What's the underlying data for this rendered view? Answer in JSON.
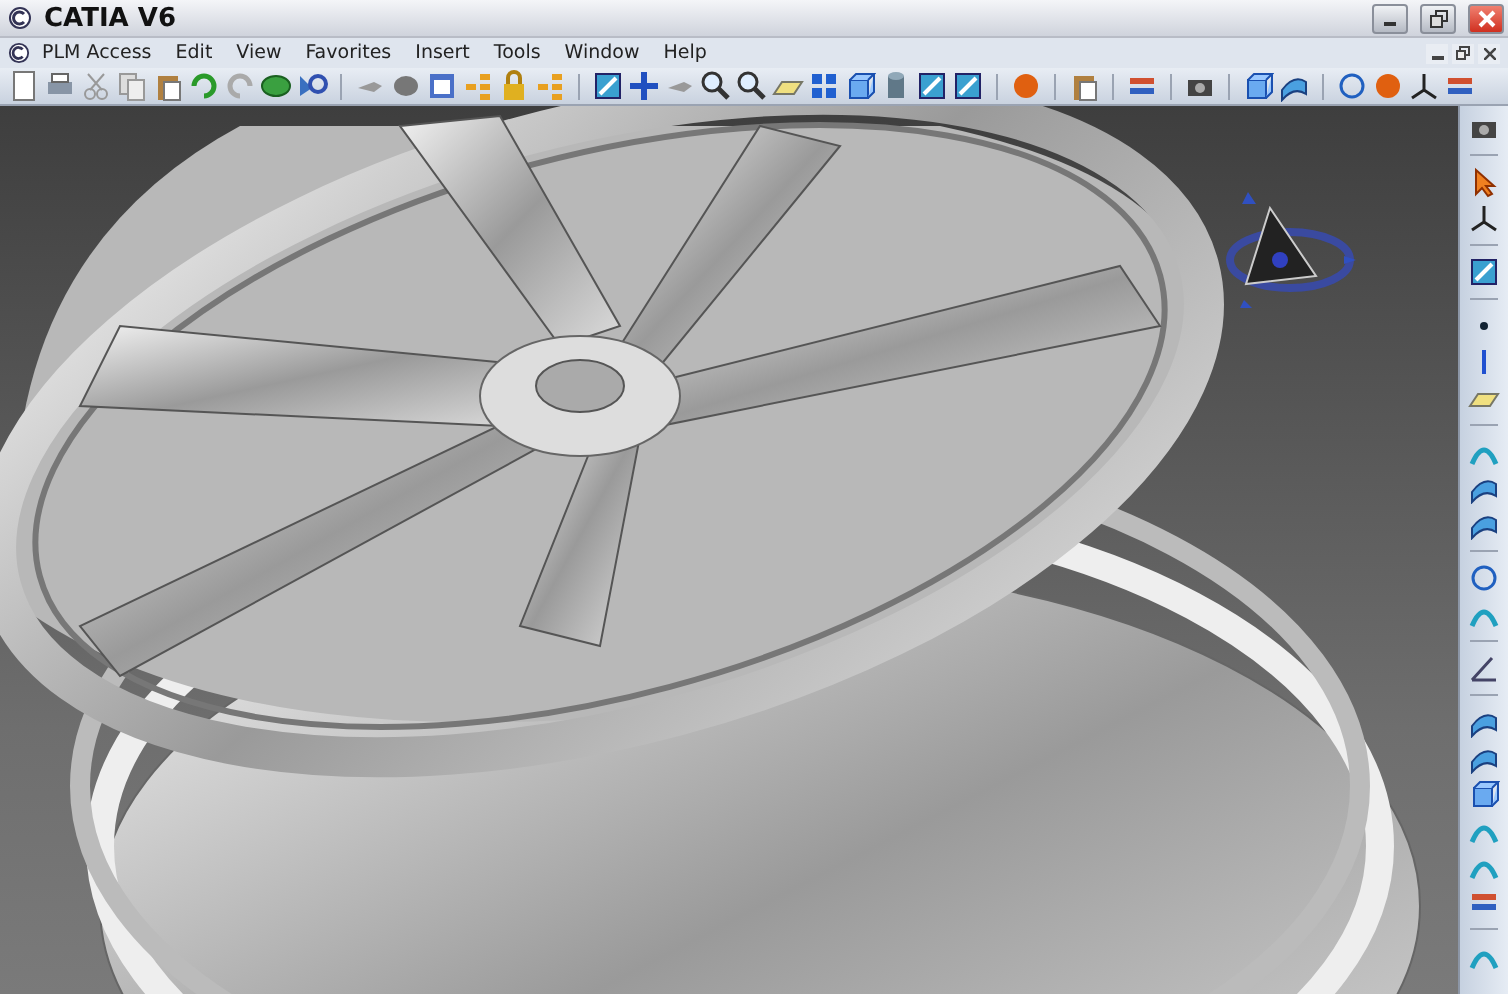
{
  "window": {
    "title": "CATIA V6"
  },
  "menu": [
    {
      "label": "PLM Access"
    },
    {
      "label": "Edit"
    },
    {
      "label": "View"
    },
    {
      "label": "Favorites"
    },
    {
      "label": "Insert"
    },
    {
      "label": "Tools"
    },
    {
      "label": "Window"
    },
    {
      "label": "Help"
    }
  ]
}
